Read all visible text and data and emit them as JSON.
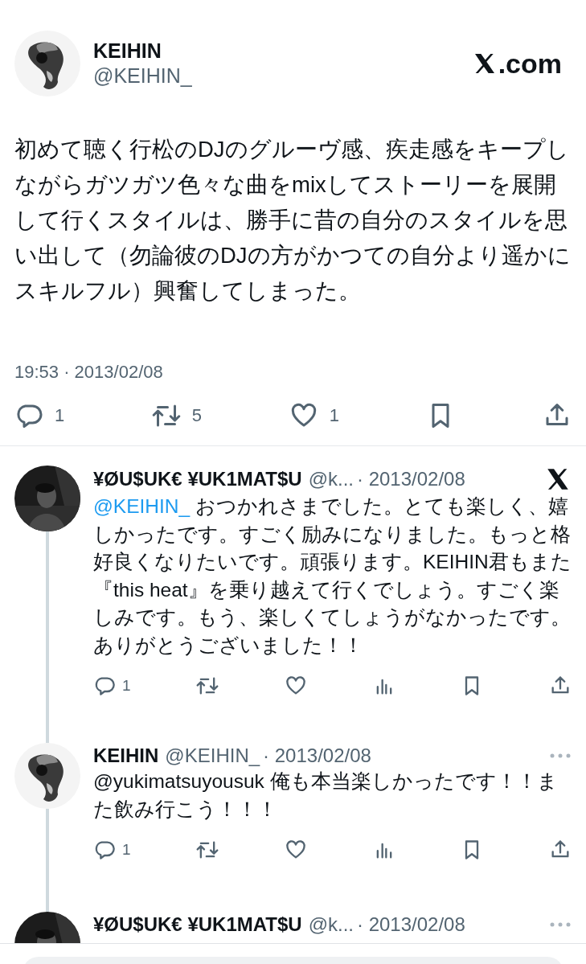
{
  "header": {
    "name": "KEIHIN",
    "handle": "@KEIHIN_",
    "brand_suffix": ".com"
  },
  "tweet": {
    "text": "初めて聴く行松のDJのグルーヴ感、疾走感をキープしながらガツガツ色々な曲をmixしてストーリーを展開して行くスタイルは、勝手に昔の自分のスタイルを思い出して（勿論彼のDJの方がかつての自分より遥かにスキルフル）興奮してしまった。",
    "time": "19:53 · 2013/02/08",
    "actions": [
      {
        "kind": "reply",
        "count": "1"
      },
      {
        "kind": "retweet",
        "count": "5"
      },
      {
        "kind": "like",
        "count": "1"
      },
      {
        "kind": "bookmark"
      },
      {
        "kind": "share"
      }
    ]
  },
  "replies": [
    {
      "avatar": {
        "kind": "portrait"
      },
      "name": "¥ØU$UK€ ¥UK1MAT$U",
      "handle": "@k...",
      "date": "· 2013/02/08",
      "corner": {
        "kind": "x-logo"
      },
      "mention": "@KEIHIN_",
      "text": "おつかれさまでした。とても楽しく、嬉しかったです。すごく励みになりました。もっと格好良くなりたいです。頑張ります。KEIHIN君もまた『this heat』を乗り越えて行くでしょう。すごく楽しみです。もう、楽しくてしょうがなかったです。ありがとうございました！！",
      "actions": [
        {
          "kind": "reply",
          "count": "1"
        },
        {
          "kind": "retweet"
        },
        {
          "kind": "like"
        },
        {
          "kind": "views"
        },
        {
          "kind": "bookmark"
        },
        {
          "kind": "share"
        }
      ]
    },
    {
      "avatar": {
        "kind": "flower"
      },
      "name": "KEIHIN",
      "handle": "@KEIHIN_",
      "date": "· 2013/02/08",
      "corner": {
        "kind": "more"
      },
      "text": "@yukimatsuyousuk 俺も本当楽しかったです！！また飲み行こう！！！",
      "actions": [
        {
          "kind": "reply",
          "count": "1"
        },
        {
          "kind": "retweet"
        },
        {
          "kind": "like"
        },
        {
          "kind": "views"
        },
        {
          "kind": "bookmark"
        },
        {
          "kind": "share"
        }
      ]
    },
    {
      "avatar": {
        "kind": "portrait"
      },
      "name": "¥ØU$UK€ ¥UK1MAT$U",
      "handle": "@k...",
      "date": "· 2013/02/08",
      "corner": {
        "kind": "more"
      }
    }
  ]
}
